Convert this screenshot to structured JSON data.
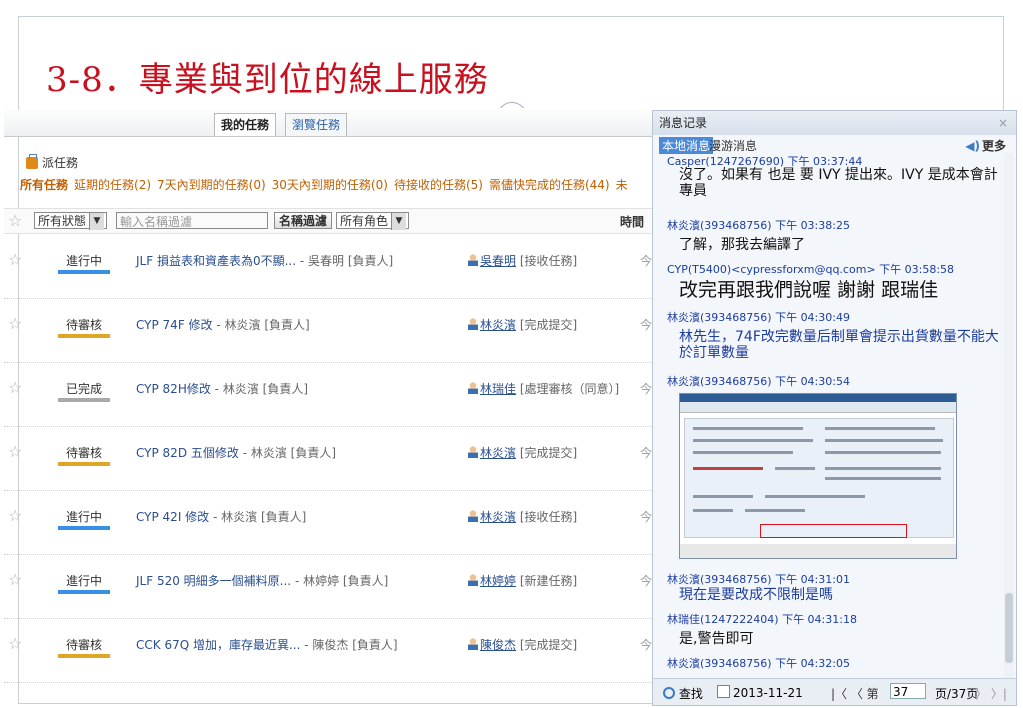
{
  "slide": {
    "title": "3-8．專業與到位的線上服務"
  },
  "task_panel": {
    "tabs": {
      "my_tasks": "我的任務",
      "browse_tasks": "瀏覽任務"
    },
    "assign_label": "派任務",
    "filters": [
      "所有任務",
      "延期的任務(2)",
      "7天內到期的任務(0)",
      "30天內到期的任務(0)",
      "待接收的任務(5)",
      "需儘快完成的任務(44)",
      "未"
    ],
    "toolbar": {
      "status_select": "所有狀態",
      "search_placeholder": "輸入名稱過濾",
      "filter_button": "名稱過濾",
      "role_select": "所有角色",
      "time_header": "時間"
    },
    "rows": [
      {
        "status": "進行中",
        "status_color": "#3a8ee6",
        "title": "JLF 損益表和資產表為0不顯...",
        "owner": "- 吳春明 [負責人]",
        "user": "吳春明",
        "action": "[接收任務]",
        "cut": "今"
      },
      {
        "status": "待審核",
        "status_color": "#e0a526",
        "title": "CYP 74F 修改",
        "owner": "- 林炎濱 [負責人]",
        "user": "林炎濱",
        "action": "[完成提交]",
        "cut": "今"
      },
      {
        "status": "已完成",
        "status_color": "#a9a9a9",
        "title": "CYP 82H修改",
        "owner": "- 林炎濱 [負責人]",
        "user": "林瑞佳",
        "action": "[處理審核（同意）]",
        "cut": "今"
      },
      {
        "status": "待審核",
        "status_color": "#e0a526",
        "title": "CYP 82D 五個修改",
        "owner": "- 林炎濱 [負責人]",
        "user": "林炎濱",
        "action": "[完成提交]",
        "cut": "今"
      },
      {
        "status": "進行中",
        "status_color": "#3a8ee6",
        "title": "CYP 42I 修改",
        "owner": "- 林炎濱 [負責人]",
        "user": "林炎濱",
        "action": "[接收任務]",
        "cut": "今"
      },
      {
        "status": "進行中",
        "status_color": "#3a8ee6",
        "title": "JLF 520 明細多一個補料原...",
        "owner": "- 林婷婷 [負責人]",
        "user": "林婷婷",
        "action": "[新建任務]",
        "cut": "今"
      },
      {
        "status": "待審核",
        "status_color": "#e0a526",
        "title": "CCK 67Q 增加，庫存最近異...",
        "owner": "- 陳俊杰 [負責人]",
        "user": "陳俊杰",
        "action": "[完成提交]",
        "cut": "今"
      }
    ]
  },
  "chat": {
    "title": "消息记录",
    "close": "×",
    "tab_local": "本地消息",
    "tab_roam": "漫游消息",
    "more": "更多",
    "messages": [
      {
        "meta": "Casper(1247267690) 下午 03:37:44",
        "text": "沒了。如果有 也是 要 IVY 提出來。IVY 是成本會計專員"
      },
      {
        "meta": "林炎濱(393468756) 下午 03:38:25",
        "text": "了解，那我去編譯了"
      },
      {
        "meta": "CYP(T5400)<cypressforxm@qq.com> 下午 03:58:58",
        "text": "改完再跟我們說喔 謝謝 跟瑞佳"
      },
      {
        "meta": "林炎濱(393468756) 下午 04:30:49",
        "text": "林先生，74F改完數量后制單會提示出貨數量不能大於訂單數量"
      },
      {
        "meta": "林炎濱(393468756) 下午 04:30:54",
        "text": ""
      },
      {
        "meta": "林炎濱(393468756) 下午 04:31:01",
        "text": "現在是要改成不限制是嗎"
      },
      {
        "meta": "林瑞佳(1247222404) 下午 04:31:18",
        "text": "是,警告即可"
      },
      {
        "meta": "林炎濱(393468756) 下午 04:32:05",
        "text": ""
      }
    ],
    "footer": {
      "find": "查找",
      "date": "2013-11-21",
      "nav": "|〈  〈  第",
      "page": "37",
      "total": "页/37页",
      "next": "〉 〉|"
    }
  }
}
